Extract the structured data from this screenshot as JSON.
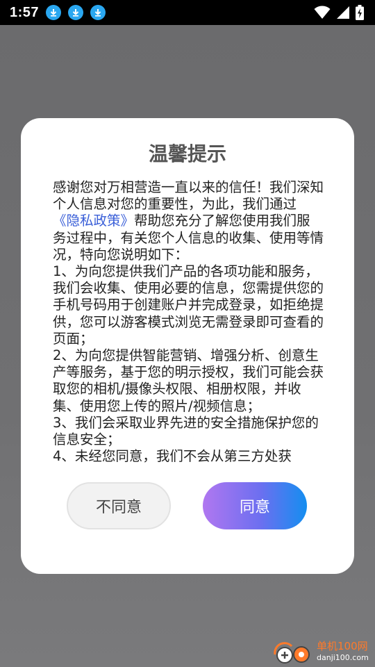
{
  "status_bar": {
    "time": "1:57",
    "download_icons": [
      "download-icon",
      "download-icon",
      "download-icon"
    ],
    "icons": [
      "wifi-icon",
      "signal-icon",
      "battery-charging-icon"
    ]
  },
  "dialog": {
    "title": "温馨提示",
    "content": {
      "before_link": "感谢您对万相营造一直以来的信任！我们深知个人信息对您的重要性，为此，我们通过",
      "link": "《隐私政策》",
      "after_link": "帮助您充分了解您使用我们服务过程中，有关您个人信息的收集、使用等情况，特向您说明如下：\n1、为向您提供我们产品的各项功能和服务，我们会收集、使用必要的信息，您需提供您的手机号码用于创建账户并完成登录，如拒绝提供，您可以游客模式浏览无需登录即可查看的页面；\n2、为向您提供智能营销、增强分析、创意生产等服务，基于您的明示授权，我们可能会获取您的相机/摄像头权限、相册权限，并收集、使用您上传的照片/视频信息；\n3、我们会采取业界先进的安全措施保护您的信息安全；\n4、未经您同意，我们不会从第三方处获"
    },
    "buttons": {
      "disagree": "不同意",
      "agree": "同意"
    }
  },
  "watermark": {
    "name": "单机100网",
    "domain": "danji100.com"
  },
  "colors": {
    "link": "#3a5fd8",
    "agree_gradient_start": "#b077f0",
    "agree_gradient_end": "#148ef0",
    "download_badge": "#2aa7f0"
  }
}
